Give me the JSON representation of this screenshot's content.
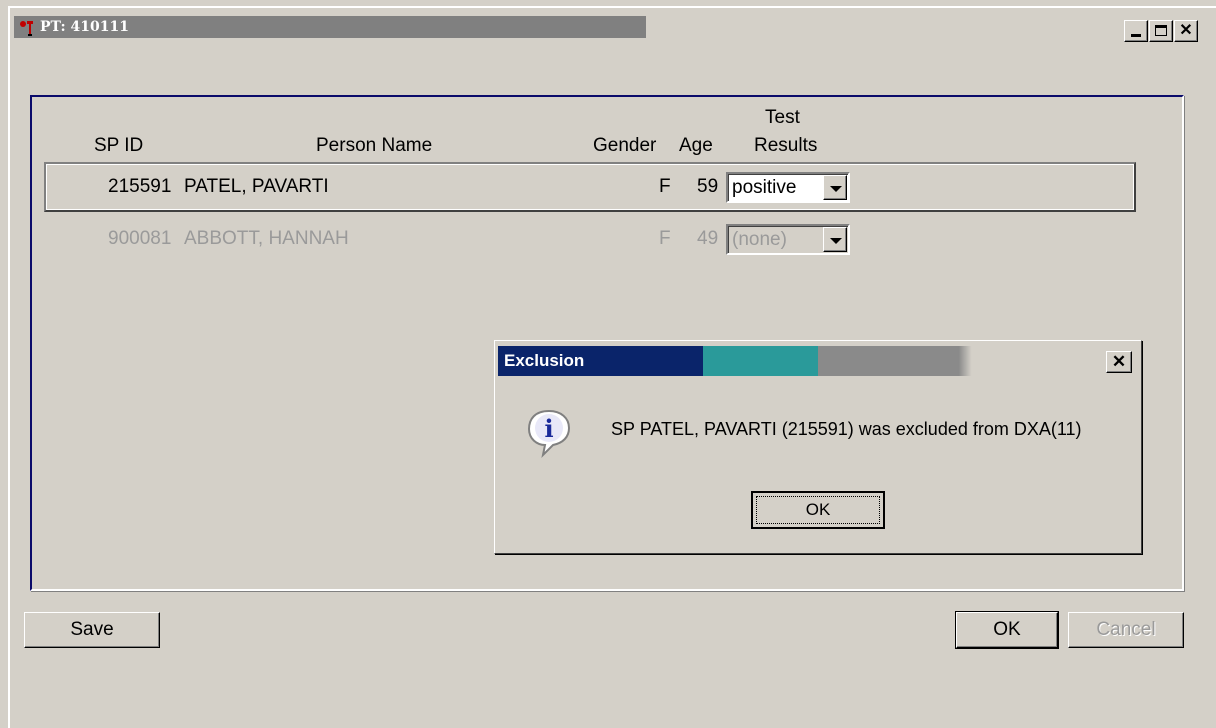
{
  "window": {
    "title": "PT: 410111"
  },
  "table": {
    "headers": {
      "sp_id": "SP ID",
      "person_name": "Person Name",
      "gender": "Gender",
      "age": "Age",
      "test_results_line1": "Test",
      "test_results_line2": "Results"
    },
    "rows": [
      {
        "sp_id": "215591",
        "name": "PATEL, PAVARTI",
        "gender": "F",
        "age": "59",
        "result": "positive"
      },
      {
        "sp_id": "900081",
        "name": "ABBOTT, HANNAH",
        "gender": "F",
        "age": "49",
        "result": "(none)"
      }
    ]
  },
  "buttons": {
    "save": "Save",
    "ok": "OK",
    "cancel": "Cancel"
  },
  "dialog": {
    "title": "Exclusion",
    "message": "SP PATEL, PAVARTI  (215591) was excluded from DXA(11)",
    "ok": "OK",
    "close": "✕"
  },
  "colors": {
    "dialog_title": "#0a246a",
    "window_title": "#808080",
    "face": "#d4d0c8"
  }
}
